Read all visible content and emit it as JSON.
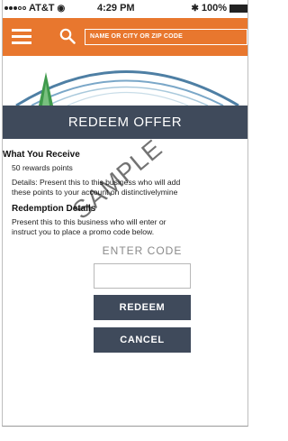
{
  "status_bar": {
    "carrier": "AT&T",
    "time": "4:29 PM",
    "battery": "100%"
  },
  "nav": {
    "search_placeholder": "NAME OR CITY OR ZIP CODE"
  },
  "header": {
    "title": "REDEEM OFFER"
  },
  "receive": {
    "title": "What You Receive",
    "points": "50 rewards points",
    "details_line1": "Details: Present this to this business who will add",
    "details_line2": "these points to your account on distinctivelymine"
  },
  "redemption": {
    "title": "Redemption Details",
    "line1": "Present this to this business who will enter or",
    "line2": "instruct you to place a promo code below."
  },
  "code": {
    "label": "ENTER CODE",
    "value": ""
  },
  "buttons": {
    "redeem": "REDEEM",
    "cancel": "CANCEL"
  },
  "watermark": "SAMPLE",
  "colors": {
    "brand_orange": "#e8772e",
    "header_slate": "#3f4a5b"
  },
  "icons": [
    "menu-icon",
    "search-icon",
    "wifi-icon",
    "bluetooth-icon",
    "battery-icon"
  ]
}
